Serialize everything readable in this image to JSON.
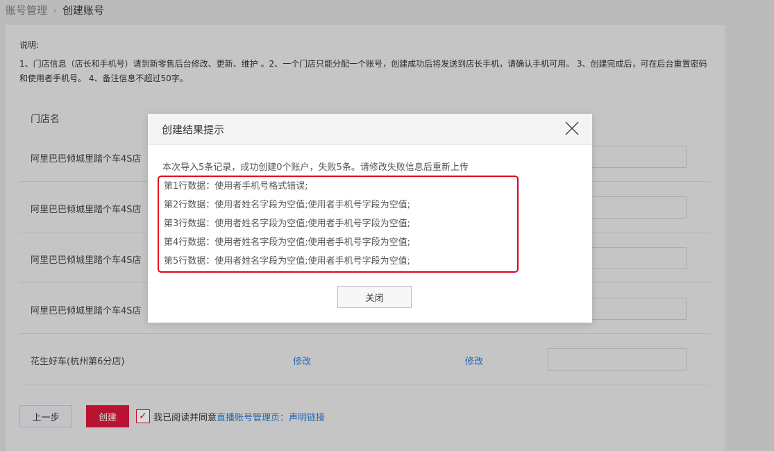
{
  "breadcrumb": {
    "parent": "账号管理",
    "separator": "›",
    "current": "创建账号"
  },
  "notes": {
    "title": "说明:",
    "text": "1、门店信息（店长和手机号）请到新零售后台修改、更新、维护 。2、一个门店只能分配一个账号，创建成功后将发送到店长手机，请确认手机可用。 3、创建完成后，可在后台重置密码和使用者手机号。 4、备注信息不超过50字。"
  },
  "table": {
    "header_store": "门店名",
    "rows": [
      {
        "store": "阿里巴巴倾城里踏个车4S店"
      },
      {
        "store": "阿里巴巴倾城里踏个车4S店"
      },
      {
        "store": "阿里巴巴倾城里踏个车4S店"
      },
      {
        "store": "阿里巴巴倾城里踏个车4S店"
      },
      {
        "store": "花生好车(杭州第6分店)",
        "edit1": "修改",
        "edit2": "修改"
      }
    ]
  },
  "footer": {
    "prev_label": "上一步",
    "create_label": "创建",
    "checkbox_mark": "✓",
    "agree_text": "我已阅读并同意",
    "agree_link": "直播账号管理页：声明链接"
  },
  "modal": {
    "title": "创建结果提示",
    "summary": "本次导入5条记录，成功创建0个账户，失败5条。请修改失败信息后重新上传",
    "errors": [
      "第1行数据：使用者手机号格式错误;",
      "第2行数据：使用者姓名字段为空值;使用者手机号字段为空值;",
      "第3行数据：使用者姓名字段为空值;使用者手机号字段为空值;",
      "第4行数据：使用者姓名字段为空值;使用者手机号字段为空值;",
      "第5行数据：使用者姓名字段为空值;使用者手机号字段为空值;"
    ],
    "close_label": "关闭"
  },
  "colors": {
    "accent": "#d9183b",
    "link": "#2a7ad5",
    "highlight_border": "#e4001f"
  },
  "icons": {
    "close": "close-icon",
    "check": "check-icon"
  }
}
